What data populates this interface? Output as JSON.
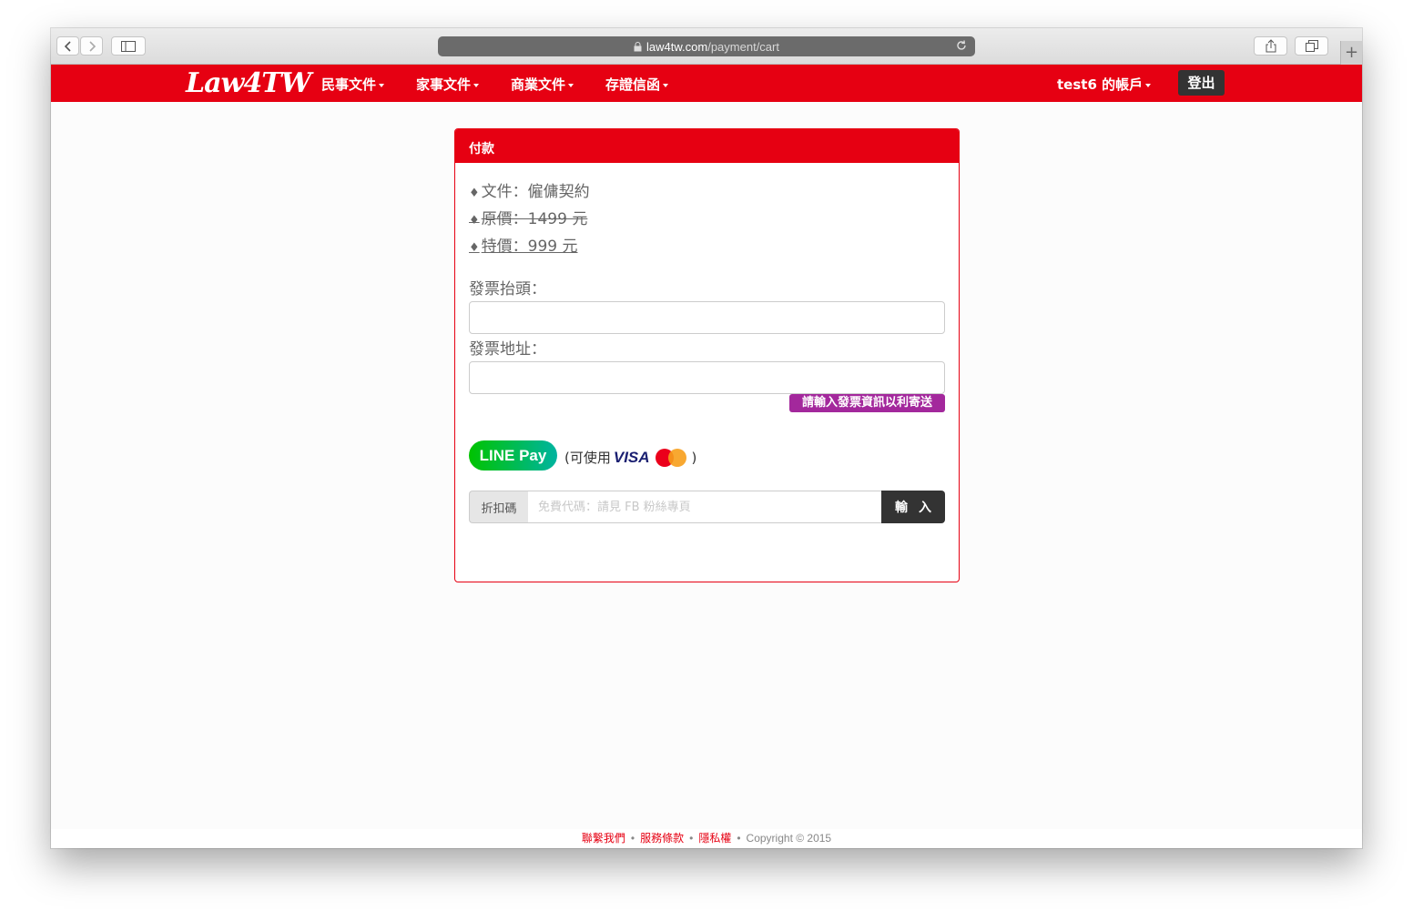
{
  "browser": {
    "host": "law4tw.com",
    "path": "/payment/cart",
    "new_tab": "+"
  },
  "nav": {
    "logo": "Law4TW",
    "items": [
      {
        "label": "民事文件"
      },
      {
        "label": "家事文件"
      },
      {
        "label": "商業文件"
      },
      {
        "label": "存證信函"
      }
    ],
    "account": "test6 的帳戶",
    "logout": "登出"
  },
  "panel": {
    "title": "付款",
    "document": "文件：僱傭契約",
    "original_price": "原價：1499 元",
    "special_price": "特價：999 元",
    "bullet": "♦",
    "invoice_title_label": "發票抬頭：",
    "invoice_address_label": "發票地址：",
    "hint": "請輸入發票資訊以利寄送",
    "linepay": "LINE Pay",
    "usable_open": "(可使用",
    "visa": "VISA",
    "usable_close": ")",
    "coupon_label": "折扣碼",
    "coupon_placeholder": "免費代碼：請見 FB 粉絲專頁",
    "coupon_button": "輸入"
  },
  "footer": {
    "contact": "聯繫我們",
    "terms": "服務條款",
    "privacy": "隱私權",
    "copyright": "Copyright © 2015",
    "separator": "•"
  },
  "colors": {
    "brand_red": "#e60012",
    "hint_purple": "#a3289c",
    "dark_button": "#333333"
  }
}
